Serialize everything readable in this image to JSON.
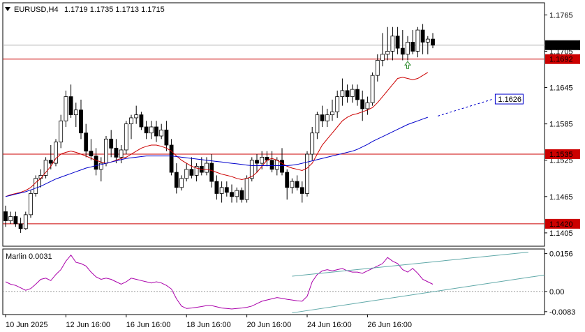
{
  "header": {
    "symbol_timeframe": "EURUSD,H4",
    "ohlc": "1.1719 1.1735 1.1713 1.1715",
    "indicator_label": "Marlin 0.0031"
  },
  "colors": {
    "bull": "#ffffff",
    "bear": "#000000",
    "ma_fast": "#cc0000",
    "ma_slow": "#0000cc",
    "level": "#cc0000",
    "oscillator": "#aa00aa",
    "channel": "#5fa8a8",
    "arrow": "#2e8b2e"
  },
  "chart_data": [
    {
      "type": "candlestick",
      "title": "",
      "xlabel": "",
      "ylabel": "",
      "ylim": [
        1.1383,
        1.1785
      ],
      "y_ticks": [
        "1.1765",
        "1.1705",
        "1.1645",
        "1.1585",
        "1.1525",
        "1.1465",
        "1.1405"
      ],
      "x_ticks": [
        "10 Jun 2025",
        "12 Jun 16:00",
        "16 Jun 16:00",
        "18 Jun 16:00",
        "20 Jun 16:00",
        "24 Jun 16:00",
        "26 Jun 16:00"
      ],
      "grid": false,
      "candles": [
        [
          1.144,
          1.145,
          1.1415,
          1.1425
        ],
        [
          1.1425,
          1.144,
          1.142,
          1.1432
        ],
        [
          1.1432,
          1.144,
          1.1415,
          1.142
        ],
        [
          1.142,
          1.143,
          1.1405,
          1.1412
        ],
        [
          1.1412,
          1.144,
          1.141,
          1.1435
        ],
        [
          1.1435,
          1.1475,
          1.143,
          1.147
        ],
        [
          1.147,
          1.15,
          1.1465,
          1.1495
        ],
        [
          1.1495,
          1.151,
          1.148,
          1.15
        ],
        [
          1.15,
          1.153,
          1.1495,
          1.1525
        ],
        [
          1.1525,
          1.155,
          1.151,
          1.152
        ],
        [
          1.152,
          1.156,
          1.1515,
          1.1555
        ],
        [
          1.1555,
          1.16,
          1.1545,
          1.159
        ],
        [
          1.159,
          1.164,
          1.158,
          1.163
        ],
        [
          1.163,
          1.165,
          1.1595,
          1.16
        ],
        [
          1.16,
          1.162,
          1.158,
          1.1608
        ],
        [
          1.1608,
          1.1625,
          1.156,
          1.157
        ],
        [
          1.157,
          1.1585,
          1.153,
          1.154
        ],
        [
          1.154,
          1.156,
          1.1525,
          1.1532
        ],
        [
          1.1532,
          1.1545,
          1.15,
          1.151
        ],
        [
          1.151,
          1.153,
          1.149,
          1.152
        ],
        [
          1.152,
          1.1565,
          1.1515,
          1.156
        ],
        [
          1.156,
          1.1575,
          1.153,
          1.1545
        ],
        [
          1.1545,
          1.156,
          1.152,
          1.153
        ],
        [
          1.153,
          1.155,
          1.152,
          1.1542
        ],
        [
          1.1542,
          1.159,
          1.1535,
          1.1585
        ],
        [
          1.1585,
          1.16,
          1.156,
          1.1595
        ],
        [
          1.1595,
          1.1615,
          1.1585,
          1.16
        ],
        [
          1.16,
          1.1605,
          1.1575,
          1.158
        ],
        [
          1.158,
          1.159,
          1.156,
          1.157
        ],
        [
          1.157,
          1.159,
          1.156,
          1.158
        ],
        [
          1.158,
          1.159,
          1.1555,
          1.1565
        ],
        [
          1.1565,
          1.1585,
          1.156,
          1.1575
        ],
        [
          1.1575,
          1.159,
          1.154,
          1.155
        ],
        [
          1.155,
          1.156,
          1.15,
          1.1505
        ],
        [
          1.1505,
          1.152,
          1.147,
          1.148
        ],
        [
          1.148,
          1.15,
          1.1475,
          1.1495
        ],
        [
          1.1495,
          1.152,
          1.149,
          1.151
        ],
        [
          1.151,
          1.153,
          1.1495,
          1.15
        ],
        [
          1.15,
          1.152,
          1.149,
          1.1515
        ],
        [
          1.1515,
          1.153,
          1.15,
          1.1505
        ],
        [
          1.1505,
          1.153,
          1.15,
          1.152
        ],
        [
          1.152,
          1.1535,
          1.148,
          1.149
        ],
        [
          1.149,
          1.15,
          1.146,
          1.147
        ],
        [
          1.147,
          1.149,
          1.1455,
          1.148
        ],
        [
          1.148,
          1.149,
          1.1465,
          1.1472
        ],
        [
          1.1472,
          1.1485,
          1.1455,
          1.1465
        ],
        [
          1.1465,
          1.148,
          1.1455,
          1.1475
        ],
        [
          1.1475,
          1.148,
          1.1455,
          1.146
        ],
        [
          1.146,
          1.15,
          1.1455,
          1.1495
        ],
        [
          1.1495,
          1.153,
          1.149,
          1.1525
        ],
        [
          1.1525,
          1.1535,
          1.1505,
          1.152
        ],
        [
          1.152,
          1.154,
          1.151,
          1.153
        ],
        [
          1.153,
          1.154,
          1.1515,
          1.1525
        ],
        [
          1.1525,
          1.154,
          1.1505,
          1.151
        ],
        [
          1.151,
          1.153,
          1.15,
          1.1525
        ],
        [
          1.1525,
          1.1545,
          1.15,
          1.1505
        ],
        [
          1.1505,
          1.151,
          1.146,
          1.148
        ],
        [
          1.148,
          1.1495,
          1.147,
          1.149
        ],
        [
          1.149,
          1.15,
          1.1475,
          1.148
        ],
        [
          1.148,
          1.149,
          1.1455,
          1.147
        ],
        [
          1.147,
          1.154,
          1.1465,
          1.1535
        ],
        [
          1.1535,
          1.158,
          1.1525,
          1.157
        ],
        [
          1.157,
          1.1605,
          1.156,
          1.16
        ],
        [
          1.16,
          1.1615,
          1.158,
          1.159
        ],
        [
          1.159,
          1.161,
          1.158,
          1.16
        ],
        [
          1.16,
          1.1625,
          1.159,
          1.1605
        ],
        [
          1.1605,
          1.164,
          1.1595,
          1.163
        ],
        [
          1.163,
          1.166,
          1.1615,
          1.164
        ],
        [
          1.164,
          1.165,
          1.162,
          1.163
        ],
        [
          1.163,
          1.165,
          1.162,
          1.1642
        ],
        [
          1.1642,
          1.165,
          1.1615,
          1.1625
        ],
        [
          1.1625,
          1.164,
          1.159,
          1.161
        ],
        [
          1.161,
          1.163,
          1.16,
          1.162
        ],
        [
          1.162,
          1.167,
          1.1615,
          1.1665
        ],
        [
          1.1665,
          1.17,
          1.1655,
          1.169
        ],
        [
          1.169,
          1.1735,
          1.168,
          1.17
        ],
        [
          1.17,
          1.1745,
          1.169,
          1.1705
        ],
        [
          1.1705,
          1.1745,
          1.169,
          1.173
        ],
        [
          1.173,
          1.1745,
          1.17,
          1.171
        ],
        [
          1.171,
          1.174,
          1.169,
          1.17
        ],
        [
          1.17,
          1.173,
          1.169,
          1.172
        ],
        [
          1.172,
          1.174,
          1.17,
          1.1705
        ],
        [
          1.1705,
          1.1745,
          1.1695,
          1.174
        ],
        [
          1.174,
          1.175,
          1.17,
          1.172
        ],
        [
          1.172,
          1.173,
          1.17,
          1.1725
        ],
        [
          1.1725,
          1.1735,
          1.171,
          1.1715
        ]
      ],
      "ma_fast": [
        1.1465,
        1.1468,
        1.147,
        1.1472,
        1.1475,
        1.148,
        1.1488,
        1.1495,
        1.1505,
        1.1515,
        1.1528,
        1.1535,
        1.1538,
        1.154,
        1.1538,
        1.1535,
        1.1532,
        1.1528,
        1.1525,
        1.1522,
        1.152,
        1.1522,
        1.1525,
        1.1528,
        1.153,
        1.1535,
        1.154,
        1.1545,
        1.1548,
        1.155,
        1.155,
        1.1548,
        1.1545,
        1.154,
        1.1532,
        1.1525,
        1.152,
        1.1515,
        1.1512,
        1.151,
        1.151,
        1.1508,
        1.1505,
        1.1502,
        1.15,
        1.1498,
        1.1495,
        1.1493,
        1.1495,
        1.1498,
        1.1505,
        1.1515,
        1.1525,
        1.1528,
        1.1525,
        1.152,
        1.1515,
        1.1512,
        1.151,
        1.1508,
        1.1512,
        1.152,
        1.1535,
        1.155,
        1.156,
        1.157,
        1.158,
        1.159,
        1.1596,
        1.16,
        1.1602,
        1.1605,
        1.1608,
        1.1612,
        1.162,
        1.163,
        1.164,
        1.165,
        1.166,
        1.1662,
        1.166,
        1.1658,
        1.166,
        1.1665,
        1.167
      ],
      "ma_slow": [
        1.1465,
        1.1467,
        1.1469,
        1.1471,
        1.1473,
        1.1476,
        1.1479,
        1.1482,
        1.1486,
        1.149,
        1.1494,
        1.1497,
        1.15,
        1.1503,
        1.1506,
        1.1509,
        1.1512,
        1.1514,
        1.1516,
        1.1518,
        1.152,
        1.1522,
        1.1524,
        1.1526,
        1.1528,
        1.1529,
        1.153,
        1.1531,
        1.1532,
        1.1532,
        1.1532,
        1.1532,
        1.1532,
        1.1532,
        1.1531,
        1.153,
        1.1529,
        1.1528,
        1.1527,
        1.1526,
        1.1525,
        1.1524,
        1.1523,
        1.1522,
        1.1521,
        1.152,
        1.1519,
        1.1518,
        1.1517,
        1.1516,
        1.1516,
        1.1516,
        1.1516,
        1.1516,
        1.1516,
        1.1516,
        1.1516,
        1.1517,
        1.1518,
        1.152,
        1.1522,
        1.1524,
        1.1526,
        1.1528,
        1.153,
        1.1532,
        1.1534,
        1.1536,
        1.1538,
        1.154,
        1.1543,
        1.1547,
        1.1551,
        1.1556,
        1.156,
        1.1564,
        1.1568,
        1.1572,
        1.1576,
        1.158,
        1.1584,
        1.1587,
        1.159,
        1.1593,
        1.1596
      ],
      "ma_slow_projection": [
        [
          86,
          1.1598
        ],
        [
          97,
          1.1626
        ]
      ],
      "levels": [
        {
          "value": 1.1692,
          "label": "1.1692",
          "style": "red"
        },
        {
          "value": 1.1535,
          "label": "1.1535",
          "style": "red"
        },
        {
          "value": 1.142,
          "label": "1.1420",
          "style": "red"
        },
        {
          "value": 1.1626,
          "label": "1.1626",
          "style": "blue"
        },
        {
          "value": 1.1715,
          "label": "1.1715",
          "style": "price"
        }
      ],
      "current_price": 1.1715,
      "arrow_up": {
        "index": 80,
        "value": 1.1688
      }
    },
    {
      "type": "line",
      "title": "",
      "xlabel": "",
      "ylabel": "",
      "ylim": [
        -0.0095,
        0.0175
      ],
      "y_ticks": [
        "0.0156",
        "0.00",
        "-0.0083"
      ],
      "zero_line": 0.0,
      "series": [
        {
          "values": [
            0.004,
            0.003,
            0.0025,
            0.0015,
            0.0005,
            0.0012,
            0.003,
            0.005,
            0.0055,
            0.0045,
            0.007,
            0.009,
            0.0125,
            0.015,
            0.012,
            0.0115,
            0.0105,
            0.008,
            0.006,
            0.005,
            0.0055,
            0.005,
            0.004,
            0.003,
            0.004,
            0.0055,
            0.005,
            0.0045,
            0.004,
            0.0035,
            0.004,
            0.0035,
            0.0025,
            0.001,
            -0.003,
            -0.006,
            -0.007,
            -0.0068,
            -0.0065,
            -0.0062,
            -0.0058,
            -0.0058,
            -0.0063,
            -0.0068,
            -0.007,
            -0.0072,
            -0.007,
            -0.0068,
            -0.0065,
            -0.006,
            -0.005,
            -0.004,
            -0.0035,
            -0.003,
            -0.0025,
            -0.0028,
            -0.0032,
            -0.0035,
            -0.0038,
            -0.004,
            -0.002,
            0.004,
            0.007,
            0.0085,
            0.009,
            0.0085,
            0.009,
            0.0095,
            0.0085,
            0.008,
            0.008,
            0.0075,
            0.0085,
            0.0095,
            0.0105,
            0.0115,
            0.014,
            0.0125,
            0.0115,
            0.009,
            0.008,
            0.0095,
            0.0075,
            0.005,
            0.004,
            0.003
          ]
        }
      ],
      "channel_upper": [
        [
          57,
          0.0063
        ],
        [
          104,
          0.0162
        ]
      ],
      "channel_lower": [
        [
          57,
          -0.0088
        ],
        [
          128,
          0.0068
        ]
      ]
    }
  ]
}
